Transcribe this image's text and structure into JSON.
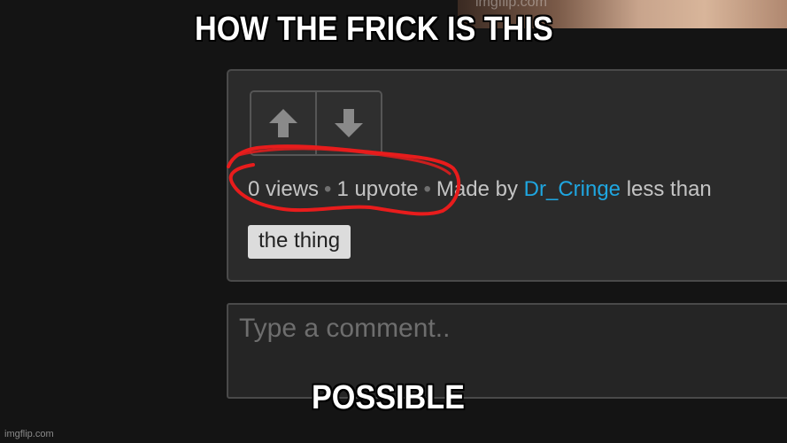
{
  "meme": {
    "top_caption": "HOW THE FRICK IS THIS",
    "bottom_caption": "POSSIBLE",
    "watermark": "imgflip.com"
  },
  "post": {
    "views": "0 views",
    "separator": "•",
    "upvotes": "1 upvote",
    "made_by_prefix": "Made by",
    "author": "Dr_Cringe",
    "time_suffix": "less than",
    "tag": "the thing"
  },
  "icons": {
    "upvote": "arrow-up-icon",
    "downvote": "arrow-down-icon"
  },
  "comment": {
    "placeholder": "Type a comment.."
  },
  "colors": {
    "background": "#141414",
    "card": "#2b2b2b",
    "link": "#1fa6e0",
    "scribble": "#e81c1c"
  }
}
